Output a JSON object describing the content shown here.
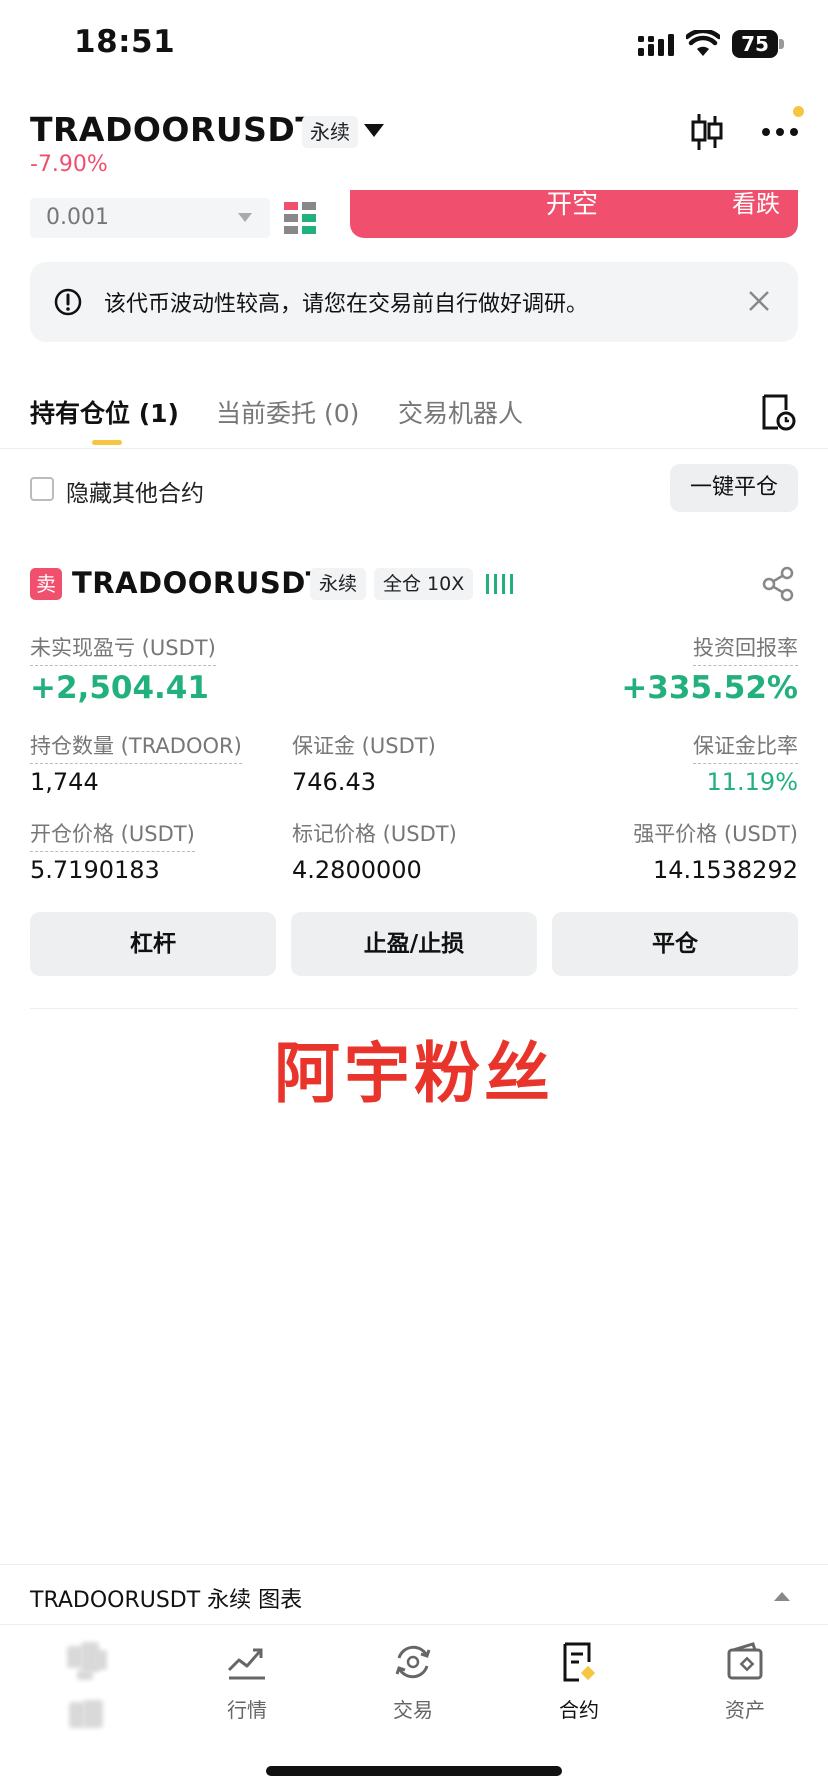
{
  "status_bar": {
    "time": "18:51",
    "battery": "75"
  },
  "header": {
    "pair": "TRADOORUSDT",
    "contract_type": "永续",
    "change_pct": "-7.90%"
  },
  "order": {
    "quantity_placeholder": "0.001",
    "short_button": "开空",
    "short_sub": "看跌"
  },
  "warning": {
    "text": "该代币波动性较高，请您在交易前自行做好调研。"
  },
  "tabs": [
    {
      "label": "持有仓位 (1)"
    },
    {
      "label": "当前委托 (0)"
    },
    {
      "label": "交易机器人"
    }
  ],
  "filters": {
    "hide_other_label": "隐藏其他合约",
    "close_all_label": "一键平仓"
  },
  "position": {
    "side": "卖",
    "symbol": "TRADOORUSDT",
    "type": "永续",
    "margin_mode": "全仓 10X",
    "unrealized_pnl_label": "未实现盈亏 (USDT)",
    "unrealized_pnl": "+2,504.41",
    "roe_label": "投资回报率",
    "roe": "+335.52%",
    "qty_label": "持仓数量 (TRADOOR)",
    "qty": "1,744",
    "margin_label": "保证金 (USDT)",
    "margin": "746.43",
    "margin_ratio_label": "保证金比率",
    "margin_ratio": "11.19%",
    "entry_label": "开仓价格 (USDT)",
    "entry": "5.7190183",
    "mark_label": "标记价格 (USDT)",
    "mark": "4.2800000",
    "liq_label": "强平价格 (USDT)",
    "liq": "14.1538292",
    "actions": [
      "杠杆",
      "止盈/止损",
      "平仓"
    ]
  },
  "watermark": "阿宇粉丝",
  "chart_bar": {
    "text": "TRADOORUSDT 永续 图表"
  },
  "nav": {
    "market": "行情",
    "trade": "交易",
    "contract": "合约",
    "assets": "资产"
  },
  "colors": {
    "sell_red": "#f0506e",
    "profit_green": "#22b07d",
    "accent_yellow": "#f6c542",
    "watermark_red": "#e8342b"
  }
}
